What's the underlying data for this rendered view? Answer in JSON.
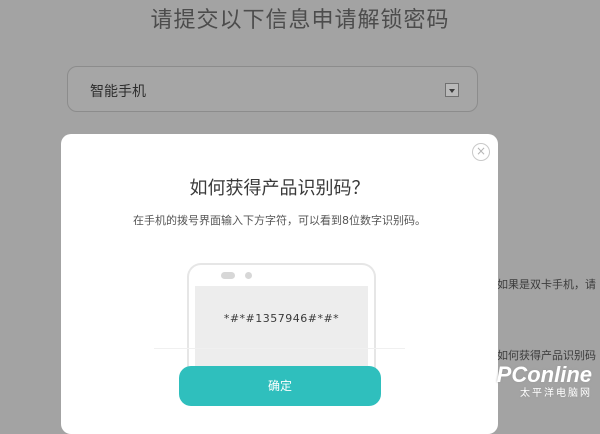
{
  "page": {
    "title": "请提交以下信息申请解锁密码",
    "device_select": {
      "value": "智能手机"
    },
    "notes": [
      "如果是双卡手机，请",
      "如何获得产品识别码"
    ]
  },
  "modal": {
    "close_icon": "×",
    "title": "如何获得产品识别码？",
    "description": "在手机的拨号界面输入下方字符，可以看到8位数字识别码。",
    "dial_code": "*#*#1357946#*#*",
    "confirm_label": "确定"
  },
  "watermark": {
    "logo": "PConline",
    "subtitle": "太平洋电脑网"
  },
  "colors": {
    "accent": "#2fbfbd",
    "overlay": "#a3a3a3"
  }
}
